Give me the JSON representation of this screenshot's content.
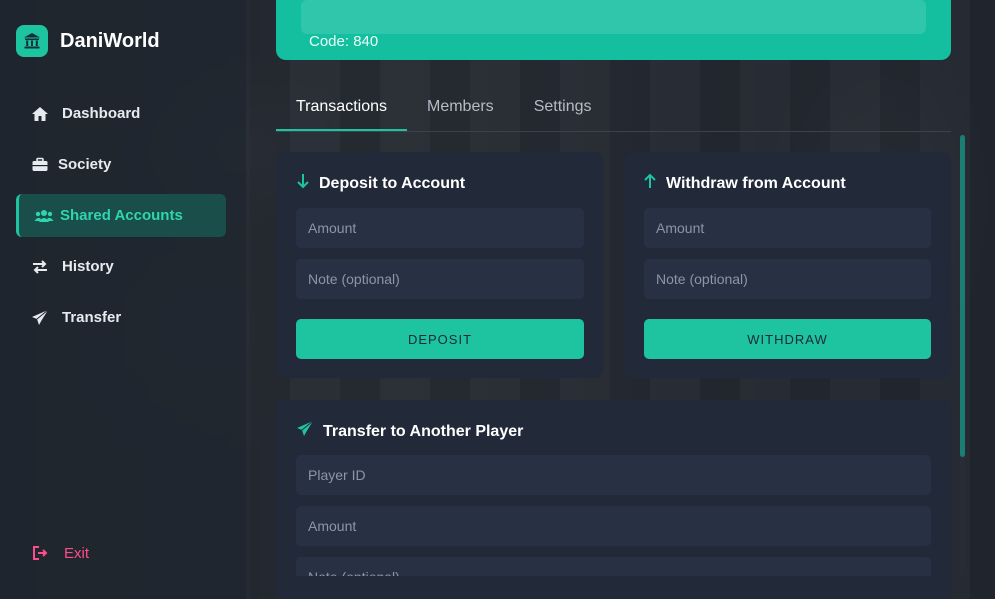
{
  "app": {
    "name": "DaniWorld"
  },
  "sidebar": {
    "items": [
      {
        "label": "Dashboard",
        "icon": "home-icon"
      },
      {
        "label": "Society",
        "icon": "briefcase-icon"
      },
      {
        "label": "Shared Accounts",
        "icon": "users-icon",
        "active": true
      },
      {
        "label": "History",
        "icon": "exchange-icon"
      },
      {
        "label": "Transfer",
        "icon": "paper-plane-icon"
      }
    ],
    "exit_label": "Exit"
  },
  "banner": {
    "code_text": "Code: 840"
  },
  "tabs": [
    {
      "label": "Transactions",
      "active": true
    },
    {
      "label": "Members"
    },
    {
      "label": "Settings"
    }
  ],
  "deposit": {
    "title": "Deposit to Account",
    "amount_placeholder": "Amount",
    "note_placeholder": "Note (optional)",
    "button_label": "DEPOSIT"
  },
  "withdraw": {
    "title": "Withdraw from Account",
    "amount_placeholder": "Amount",
    "note_placeholder": "Note (optional)",
    "button_label": "WITHDRAW"
  },
  "transfer": {
    "title": "Transfer to Another Player",
    "player_placeholder": "Player ID",
    "amount_placeholder": "Amount",
    "note_placeholder": "Note (optional)"
  },
  "colors": {
    "accent": "#1ec4a0",
    "sidebar_bg": "#1e242e",
    "card_bg": "#222a3a",
    "exit": "#ff4d8a"
  }
}
